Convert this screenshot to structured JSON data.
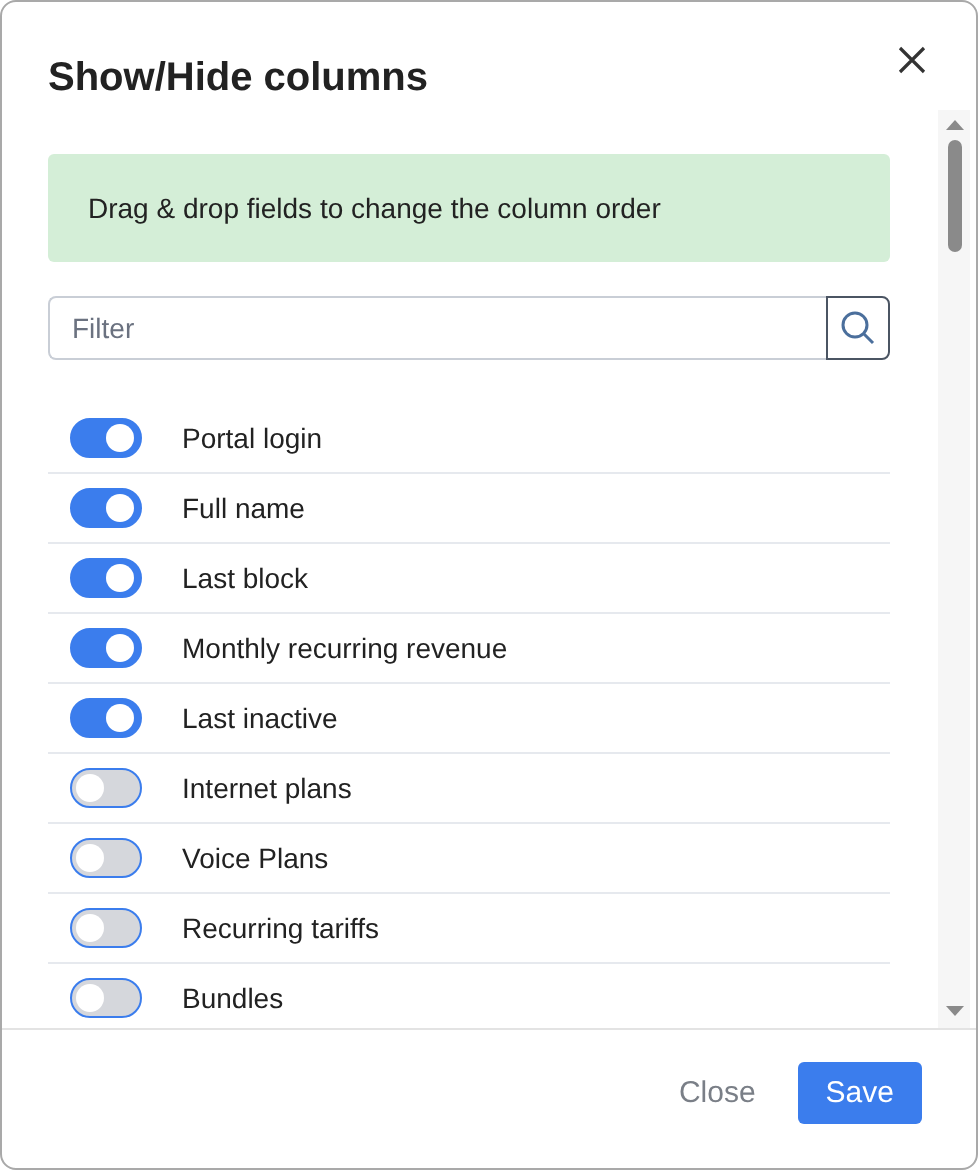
{
  "dialog": {
    "title": "Show/Hide columns"
  },
  "hint": "Drag & drop fields to change the column order",
  "filter": {
    "placeholder": "Filter"
  },
  "columns": [
    {
      "label": "Portal login",
      "on": true
    },
    {
      "label": "Full name",
      "on": true
    },
    {
      "label": "Last block",
      "on": true
    },
    {
      "label": "Monthly recurring revenue",
      "on": true
    },
    {
      "label": "Last inactive",
      "on": true
    },
    {
      "label": "Internet plans",
      "on": false
    },
    {
      "label": "Voice Plans",
      "on": false
    },
    {
      "label": "Recurring tariffs",
      "on": false
    },
    {
      "label": "Bundles",
      "on": false
    }
  ],
  "buttons": [
    {
      "label": "Close",
      "kind": "secondary"
    },
    {
      "label": "Save",
      "kind": "primary"
    }
  ]
}
